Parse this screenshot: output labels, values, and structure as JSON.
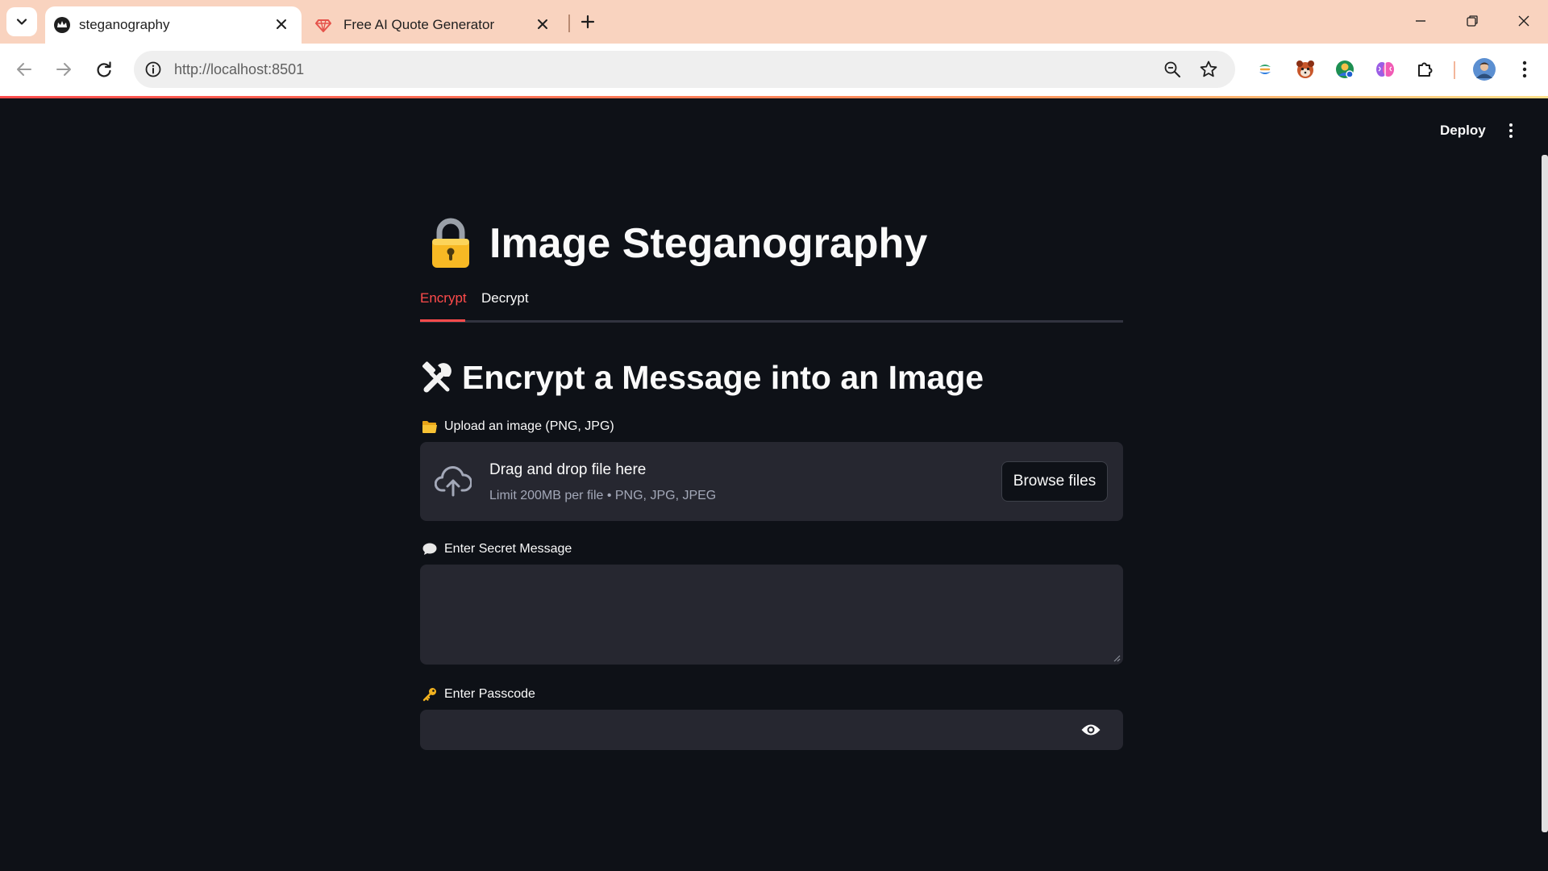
{
  "browser": {
    "tabs": [
      {
        "title": "steganography",
        "favicon": "crown-icon",
        "active": true
      },
      {
        "title": "Free AI Quote Generator",
        "favicon": "gem-icon",
        "active": false
      }
    ],
    "url": "http://localhost:8501",
    "extensions": [
      "extension-leaf-icon",
      "extension-panda-icon",
      "extension-globe-icon",
      "extension-brain-icon",
      "puzzle-icon"
    ],
    "accent_color": "#f9d3bf"
  },
  "app": {
    "header": {
      "deploy_label": "Deploy"
    },
    "title_icon": "lock-icon",
    "title": "Image Steganography",
    "tabs": [
      {
        "label": "Encrypt",
        "selected": true
      },
      {
        "label": "Decrypt",
        "selected": false
      }
    ],
    "section_icon": "tools-icon",
    "section_title": "Encrypt a Message into an Image",
    "upload": {
      "icon": "folder-icon",
      "label": "Upload an image (PNG, JPG)",
      "dropzone_title": "Drag and drop file here",
      "dropzone_hint": "Limit 200MB per file • PNG, JPG, JPEG",
      "browse_label": "Browse files"
    },
    "message": {
      "icon": "speech-bubble-icon",
      "label": "Enter Secret Message",
      "value": ""
    },
    "passcode": {
      "icon": "key-icon",
      "label": "Enter Passcode",
      "value": ""
    },
    "colors": {
      "background": "#0e1117",
      "input_bg": "#262730",
      "primary": "#ff4b4b",
      "text": "#fafafa"
    }
  }
}
